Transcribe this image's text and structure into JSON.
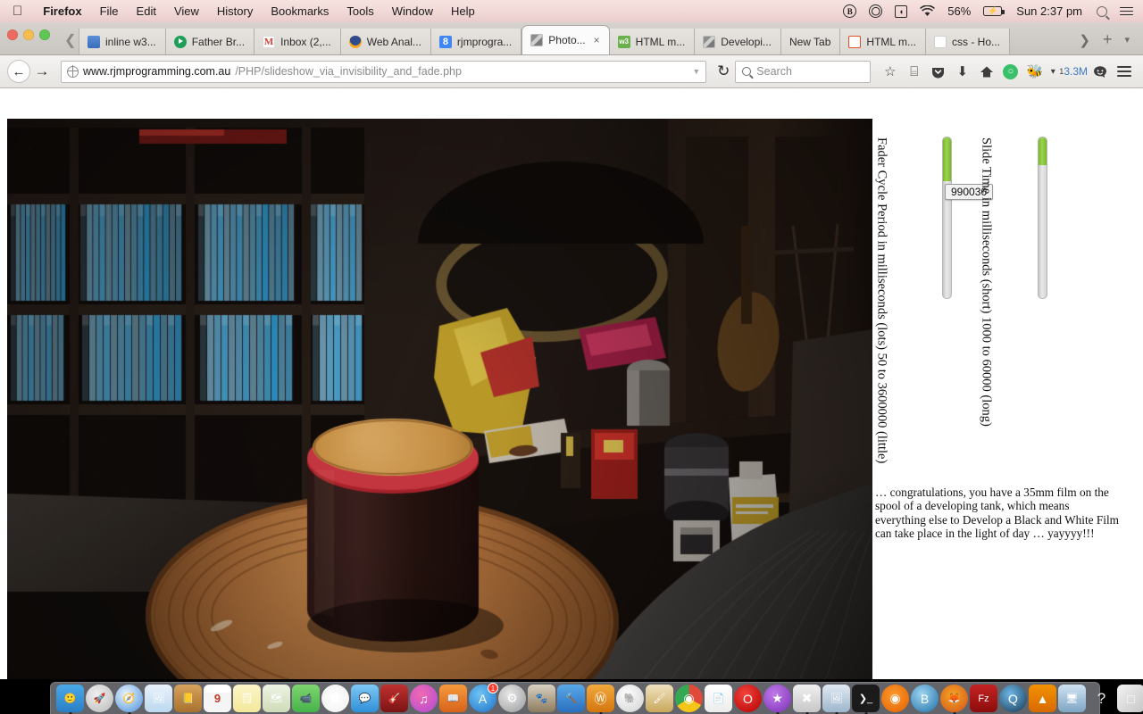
{
  "menubar": {
    "apple_icon": "apple-icon",
    "items": [
      {
        "label": "Firefox",
        "bold": true
      },
      {
        "label": "File",
        "bold": false
      },
      {
        "label": "Edit",
        "bold": false
      },
      {
        "label": "View",
        "bold": false
      },
      {
        "label": "History",
        "bold": false
      },
      {
        "label": "Bookmarks",
        "bold": false
      },
      {
        "label": "Tools",
        "bold": false
      },
      {
        "label": "Window",
        "bold": false
      },
      {
        "label": "Help",
        "bold": false
      }
    ],
    "status": {
      "bitcoin_icon": "B",
      "battery_percent": "56%",
      "battery_icon": "⚡",
      "clock": "Sun 2:37 pm",
      "spotlight_icon": "search-icon",
      "notification_icon": "list-icon"
    },
    "background": "#f0d8d6"
  },
  "tabs": {
    "scroll_left_icon": "❮",
    "items": [
      {
        "label": "inline w3...",
        "favicon": "fav-blue",
        "active": false
      },
      {
        "label": "Father Br...",
        "favicon": "fav-play",
        "active": false
      },
      {
        "label": "Inbox (2,...",
        "favicon": "fav-gmail",
        "faviconText": "M",
        "active": false
      },
      {
        "label": "Web Anal...",
        "favicon": "fav-anal",
        "active": false
      },
      {
        "label": "rjmprogra...",
        "favicon": "fav-g",
        "faviconText": "8",
        "active": false
      },
      {
        "label": "Photo...",
        "favicon": "fav-img",
        "active": true,
        "close_icon": "×"
      },
      {
        "label": "HTML m...",
        "favicon": "fav-html5",
        "faviconText": "w3",
        "active": false
      },
      {
        "label": "Developi...",
        "favicon": "fav-img",
        "active": false
      },
      {
        "label": "New Tab",
        "favicon": "none",
        "active": false
      },
      {
        "label": "HTML m...",
        "favicon": "fav-html-orange",
        "faviconText": "■",
        "active": false
      },
      {
        "label": "css - Ho...",
        "favicon": "fav-doc",
        "active": false
      }
    ],
    "scroll_right_icon": "❯",
    "new_tab_icon": "+",
    "list_all_tabs_icon": "▾"
  },
  "navbar": {
    "back_icon": "←",
    "forward_icon": "→",
    "url_host": "www.rjmprogramming.com.au",
    "url_path": "/PHP/slideshow_via_invisibility_and_fade.php",
    "url_dropdown_icon": "▼",
    "reload_icon": "↻",
    "search_placeholder": "Search",
    "icons": [
      {
        "name": "bookmark-star-icon",
        "glyph": "☆"
      },
      {
        "name": "reader-list-icon",
        "glyph": "⌸"
      },
      {
        "name": "pocket-icon",
        "glyph": "▼"
      },
      {
        "name": "downloads-icon",
        "glyph": "⬇"
      },
      {
        "name": "home-icon",
        "glyph": "⌂"
      },
      {
        "name": "green-circle-addon-icon",
        "glyph": "◯"
      },
      {
        "name": "firebug-icon",
        "glyph": "🐞"
      },
      {
        "name": "addon-dropdown-icon",
        "glyph": "▾"
      }
    ],
    "data_count_badge": "1",
    "data_count": "3.3M",
    "smiley_icon": "☺",
    "menu_icon": "hamburger-icon"
  },
  "page": {
    "photo_alt": "dark living room photo with developing tank on wooden stool",
    "controls": [
      {
        "name": "fader-cycle-period-slider",
        "label": "Fader Cycle Period in milliseconds (lots) 50 to 3600000 (little)",
        "fill_percent": 27,
        "tooltip_value": "990036"
      },
      {
        "name": "slide-time-slider",
        "label": "Slide Time in milliseconds (short) 1000 to 60000 (long)",
        "fill_percent": 17,
        "tooltip_value": ""
      }
    ],
    "blurb": "… congratulations, you have a 35mm film on the spool of a developing tank, which means everything else to Develop a Black and White Film can take place in the light of day … yayyyy!!!",
    "accent_green": "#8ac43f"
  },
  "dock": {
    "items": [
      {
        "name": "finder-icon",
        "glyph": "🙂",
        "bg": "linear-gradient(180deg,#4aa8e8,#2a7fc4)",
        "running": true
      },
      {
        "name": "launchpad-icon",
        "glyph": "🚀",
        "bg": "radial-gradient(circle at 40% 35%,#f0f0f0,#b9b9b9)",
        "running": false
      },
      {
        "name": "safari-icon",
        "glyph": "🧭",
        "bg": "radial-gradient(circle at 40% 35%,#eaf4ff,#4a90d9)",
        "running": true
      },
      {
        "name": "preview-photo-icon",
        "glyph": "🖼",
        "bg": "linear-gradient(180deg,#e8f2fb,#bcd8ef)",
        "running": false
      },
      {
        "name": "contacts-icon",
        "glyph": "📒",
        "bg": "linear-gradient(180deg,#d7a25c,#a8712f)",
        "running": false
      },
      {
        "name": "calendar-icon",
        "glyph": "9",
        "bg": "linear-gradient(180deg,#ffffff 0 28%,#f5f5f5 29% 100%)",
        "running": false
      },
      {
        "name": "notes-icon",
        "glyph": "🗒",
        "bg": "linear-gradient(180deg,#fdf6c8,#f3e79a)",
        "running": false
      },
      {
        "name": "maps-icon",
        "glyph": "🗺",
        "bg": "linear-gradient(180deg,#eef3e3,#cfdcb8)",
        "running": false
      },
      {
        "name": "facetime-icon",
        "glyph": "📹",
        "bg": "linear-gradient(180deg,#7ed56f,#46b34a)",
        "running": false
      },
      {
        "name": "photos-icon",
        "glyph": "✿",
        "bg": "radial-gradient(circle at 50% 50%,#fff,#f0f0f0)",
        "running": false
      },
      {
        "name": "messages-icon",
        "glyph": "💬",
        "bg": "linear-gradient(180deg,#7ec8f5,#2f8fd8)",
        "running": false
      },
      {
        "name": "garageband-icon",
        "glyph": "🎸",
        "bg": "linear-gradient(180deg,#c03030,#7a1414)",
        "running": false
      },
      {
        "name": "itunes-icon",
        "glyph": "♫",
        "bg": "radial-gradient(circle at 40% 35%,#f06ab0,#b04ad8)",
        "running": false
      },
      {
        "name": "ibooks-icon",
        "glyph": "📖",
        "bg": "linear-gradient(180deg,#f59a3c,#d8631a)",
        "running": false
      },
      {
        "name": "app-store-icon",
        "glyph": "A",
        "bg": "radial-gradient(circle at 40% 35%,#6fc4f5,#1f72c8)",
        "running": false,
        "badge": "1"
      },
      {
        "name": "system-preferences-icon",
        "glyph": "⚙",
        "bg": "radial-gradient(circle at 40% 35%,#e7e7e7,#9a9a9a)",
        "running": false
      },
      {
        "name": "gimp-icon",
        "glyph": "🐾",
        "bg": "linear-gradient(180deg,#d9d2c2,#8d7b5e)",
        "running": false
      },
      {
        "name": "xcode-icon",
        "glyph": "🔨",
        "bg": "linear-gradient(180deg,#59a8e8,#2a6fbe)",
        "running": false
      },
      {
        "name": "wolfram-icon",
        "glyph": "Ⓦ",
        "bg": "linear-gradient(180deg,#f2a93b,#d4760f)",
        "running": true
      },
      {
        "name": "evernote-icon",
        "glyph": "🐘",
        "bg": "radial-gradient(circle at 40% 35%,#fff,#cfcfcf)",
        "running": false
      },
      {
        "name": "paintbrush-icon",
        "glyph": "🖌",
        "bg": "linear-gradient(180deg,#f0e2c0,#caa85c)",
        "running": false
      },
      {
        "name": "chrome-icon",
        "glyph": "◉",
        "bg": "conic-gradient(#e04a3a 0 33%,#f5c518 33% 66%,#34a853 66% 100%)",
        "running": false
      },
      {
        "name": "textedit-document-icon",
        "glyph": "📄",
        "bg": "linear-gradient(180deg,#ffffff,#ececec)",
        "running": false
      },
      {
        "name": "opera-icon",
        "glyph": "O",
        "bg": "radial-gradient(circle at 40% 35%,#f5423c,#b00000)",
        "running": false
      },
      {
        "name": "imovie-icon",
        "glyph": "★",
        "bg": "radial-gradient(circle at 40% 35%,#c07ae8,#7b2fb5)",
        "running": true
      },
      {
        "name": "xquartz-icon",
        "glyph": "✖",
        "bg": "linear-gradient(180deg,#f0f0f0,#c7c7c7)",
        "running": true
      },
      {
        "name": "image-capture-icon",
        "glyph": "🖼",
        "bg": "linear-gradient(180deg,#dfe9f3,#9fb6cc)",
        "running": true
      },
      {
        "name": "terminal-icon",
        "glyph": "❯_",
        "bg": "#1b1b1b",
        "running": true
      },
      {
        "name": "avast-icon",
        "glyph": "◉",
        "bg": "radial-gradient(circle at 45% 40%,#ff9a2e,#e06000)",
        "running": false
      },
      {
        "name": "brackets-icon",
        "glyph": "B",
        "bg": "radial-gradient(circle at 40% 35%,#9fd4f0,#1e6fa8)",
        "running": false
      },
      {
        "name": "firefox-icon",
        "glyph": "🦊",
        "bg": "radial-gradient(circle at 45% 40%,#f5a623,#d2521b)",
        "running": true
      },
      {
        "name": "filezilla-icon",
        "glyph": "Fz",
        "bg": "linear-gradient(180deg,#c42222,#8c0d0d)",
        "running": false
      },
      {
        "name": "quicktime-icon",
        "glyph": "Q",
        "bg": "radial-gradient(circle at 40% 35%,#6fb8e8,#15364f)",
        "running": false
      },
      {
        "name": "vlc-icon",
        "glyph": "▲",
        "bg": "linear-gradient(180deg,#f29100,#d86a00)",
        "running": false
      },
      {
        "name": "screen-sharing-icon",
        "glyph": "🖥",
        "bg": "linear-gradient(180deg,#cfe2f2,#7fa6c4)",
        "running": false
      },
      {
        "name": "help-question-icon",
        "glyph": "?",
        "bg": "transparent",
        "running": false
      },
      {
        "name": "package-box-icon",
        "glyph": "□",
        "bg": "linear-gradient(135deg,#f2f2f2,#c6c6c6)",
        "running": false
      },
      {
        "name": "pages-document-icon",
        "glyph": "📑",
        "bg": "linear-gradient(180deg,#fff8d8,#efe2a0)",
        "running": false
      },
      {
        "name": "grapher-icon",
        "glyph": "⚈",
        "bg": "radial-gradient(circle at 40% 35%,#f5f5f5,#d0d0d0)",
        "running": true
      }
    ],
    "minimized": [
      {
        "name": "minimized-document-window",
        "glyph": "📄"
      },
      {
        "name": "minimized-firefox-window-1",
        "glyph": "▤"
      },
      {
        "name": "minimized-firefox-window-2",
        "glyph": "▤"
      }
    ],
    "trash": {
      "name": "trash-icon",
      "glyph": "🗑"
    }
  }
}
